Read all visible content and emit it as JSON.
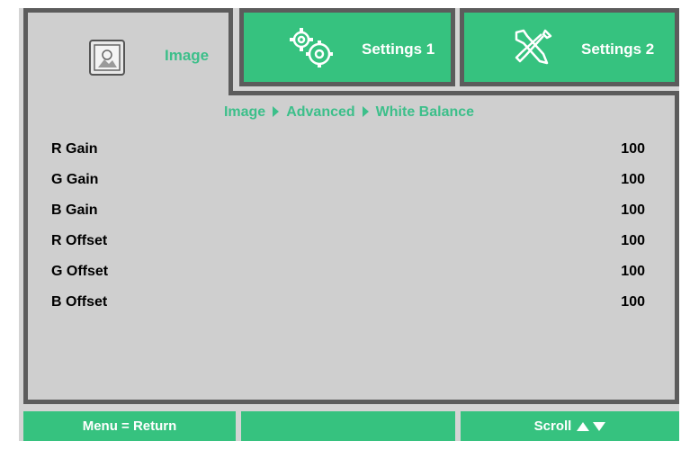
{
  "tabs": [
    {
      "label": "Image",
      "icon": "image-icon",
      "active": true
    },
    {
      "label": "Settings 1",
      "icon": "gears-icon",
      "active": false
    },
    {
      "label": "Settings 2",
      "icon": "tools-icon",
      "active": false
    }
  ],
  "breadcrumb": {
    "items": [
      "Image",
      "Advanced",
      "White Balance"
    ]
  },
  "settings": [
    {
      "name": "R Gain",
      "value": "100"
    },
    {
      "name": "G Gain",
      "value": "100"
    },
    {
      "name": "B Gain",
      "value": "100"
    },
    {
      "name": "R Offset",
      "value": "100"
    },
    {
      "name": "G Offset",
      "value": "100"
    },
    {
      "name": "B Offset",
      "value": "100"
    }
  ],
  "footer": {
    "menu_label": "Menu = Return",
    "middle_label": "",
    "scroll_label": "Scroll"
  },
  "colors": {
    "accent": "#36c27f",
    "border": "#5c5c5c",
    "panel": "#cfcfcf"
  }
}
